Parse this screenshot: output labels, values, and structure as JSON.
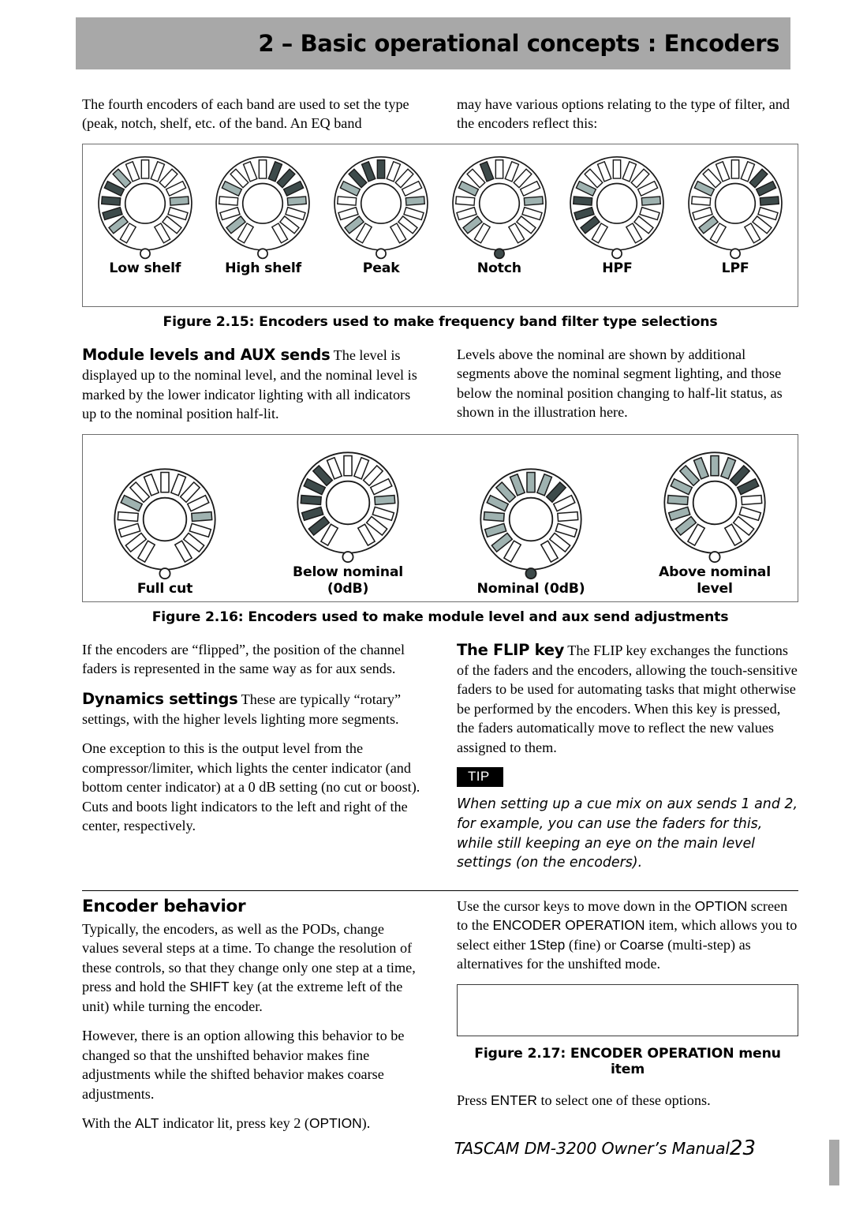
{
  "header": {
    "title": "2 – Basic operational concepts : Encoders"
  },
  "intro": {
    "left": "The fourth encoders of each band are used to set the type (peak, notch, shelf, etc. of the band. An EQ band",
    "right": "may have various options relating to the type of filter, and the encoders reflect this:"
  },
  "figure_215": {
    "caption": "Figure 2.15: Encoders used to make frequency band filter type selections",
    "encoders": [
      {
        "label": "Low shelf",
        "lit": [
          2,
          3,
          4
        ],
        "half": [
          1,
          5,
          11
        ],
        "led": "off"
      },
      {
        "label": "High shelf",
        "lit": [
          8,
          9,
          10
        ],
        "half": [
          1,
          4,
          11
        ],
        "led": "off"
      },
      {
        "label": "Peak",
        "lit": [
          5,
          6,
          7
        ],
        "half": [
          1,
          4,
          11
        ],
        "led": "off"
      },
      {
        "label": "Notch",
        "lit": [
          6
        ],
        "half": [
          1,
          4,
          11
        ],
        "led": "on"
      },
      {
        "label": "HPF",
        "lit": [
          1,
          2,
          3
        ],
        "half": [
          4,
          11
        ],
        "led": "off"
      },
      {
        "label": "LPF",
        "lit": [
          9,
          10,
          11
        ],
        "half": [
          1,
          4
        ],
        "led": "off"
      }
    ]
  },
  "module_levels": {
    "heading": "Module levels and AUX sends",
    "left_body": "The level is displayed up to the nominal level, and the nominal level is marked by the lower indicator lighting with all indicators up to the nominal position half-lit.",
    "right_body": "Levels above the nominal are shown by additional segments above the nominal segment lighting, and those below the nominal position changing to half-lit status, as shown in the illustration here."
  },
  "figure_216": {
    "caption": "Figure 2.16: Encoders used to make module level and aux send adjustments",
    "encoders": [
      {
        "label": "Full cut",
        "label2": "",
        "lit": [],
        "half": [
          4,
          11
        ],
        "led": "off"
      },
      {
        "label": "Below nominal",
        "label2": "(0dB)",
        "lit": [
          1,
          2,
          3,
          4,
          5
        ],
        "half": [
          11
        ],
        "led": "off"
      },
      {
        "label": "Nominal (0dB)",
        "label2": "",
        "lit": [
          9
        ],
        "half": [
          1,
          2,
          3,
          4,
          5,
          6,
          7,
          8
        ],
        "led": "on"
      },
      {
        "label": "Above nominal",
        "label2": "level",
        "lit": [
          9,
          10
        ],
        "half": [
          1,
          2,
          3,
          4,
          5,
          6,
          7,
          8
        ],
        "led": "off"
      }
    ]
  },
  "flip": {
    "left_p1": "If the encoders are “flipped”, the position of the channel faders is represented in the same way as for aux sends.",
    "dynamics_heading": "Dynamics settings",
    "dynamics_body": "These are typically “rotary” settings, with the higher levels lighting more segments.",
    "dynamics_p2": "One exception to this is the output level from the compressor/limiter, which lights the center indicator (and bottom center indicator) at a 0 dB setting (no cut or boost). Cuts and boots light indicators to the left and right of the center, respectively.",
    "flip_heading": "The FLIP key",
    "flip_body": "The FLIP key exchanges the functions of the faders and the encoders, allowing the touch-sensitive faders to be used for automating tasks that might otherwise be performed by the encoders. When this key is pressed, the faders automatically move to reflect the new values assigned to them.",
    "tip_label": "TIP",
    "tip_body": "When setting up a cue mix on aux sends 1 and 2, for example, you can use the faders for this, while still keeping an eye on the main level settings (on the encoders)."
  },
  "encoder_behavior": {
    "heading": "Encoder behavior",
    "left_p1_a": "Typically, the encoders, as well as the PODs, change values several steps at a time. To change the resolution of these controls, so that they change only one step at a time, press and hold the ",
    "left_p1_shift": "SHIFT",
    "left_p1_b": " key (at the extreme left of the unit) while turning the encoder.",
    "left_p2": "However, there is an option allowing this behavior to be changed so that the unshifted behavior makes fine adjustments while the shifted behavior makes coarse adjustments.",
    "left_p3_a": "With the ",
    "left_p3_alt": "ALT",
    "left_p3_b": " indicator lit, press key 2 (",
    "left_p3_opt": "OPTION",
    "left_p3_c": ").",
    "right_p1_a": "Use the cursor keys to move down in the ",
    "right_p1_option": "OPTION",
    "right_p1_b": " screen to the ",
    "right_p1_encop": "ENCODER OPERATION",
    "right_p1_c": " item, which allows you to select either ",
    "right_p1_1step": "1Step",
    "right_p1_d": " (fine) or ",
    "right_p1_coarse": "Coarse",
    "right_p1_e": " (multi-step) as alternatives for the unshifted mode.",
    "figure_217_caption": "Figure 2.17: ENCODER OPERATION menu item",
    "right_p2_a": "Press ",
    "right_p2_enter": "ENTER",
    "right_p2_b": " to select one of these options."
  },
  "footer": {
    "text": "TASCAM DM-3200 Owner’s Manual",
    "page": "23"
  },
  "colors": {
    "header_band": "#a8a8a8",
    "segment_lit": "#3d4a4a",
    "segment_half": "#9fb2b0",
    "segment_off": "#ffffff",
    "segment_stroke": "#1a1a1a",
    "figure_border": "#6e6e6e"
  }
}
